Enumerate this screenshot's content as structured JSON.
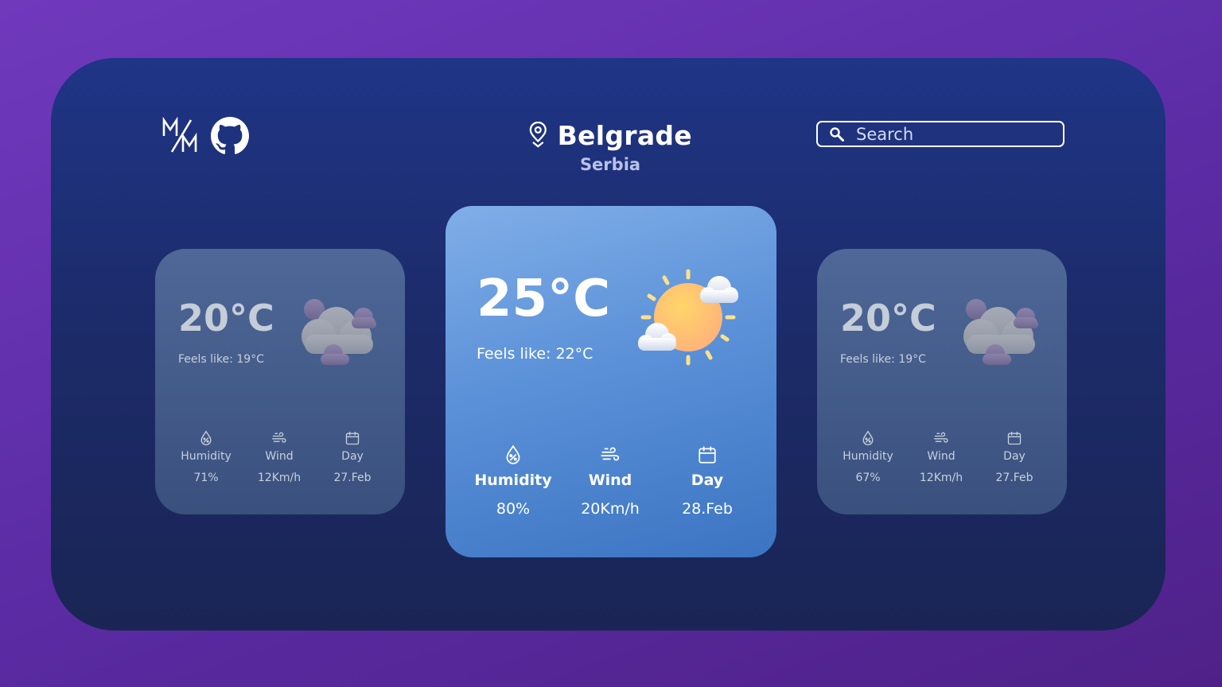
{
  "header": {
    "city": "Belgrade",
    "country": "Serbia",
    "search_placeholder": "Search"
  },
  "cards": {
    "left": {
      "temperature": "20°C",
      "feels_like": "Feels like: 19°C",
      "icon": "cloudy-icon",
      "humidity_label": "Humidity",
      "humidity_value": "71%",
      "wind_label": "Wind",
      "wind_value": "12Km/h",
      "day_label": "Day",
      "day_value": "27.Feb"
    },
    "main": {
      "temperature": "25°C",
      "feels_like": "Feels like: 22°C",
      "icon": "sun-with-clouds-icon",
      "humidity_label": "Humidity",
      "humidity_value": "80%",
      "wind_label": "Wind",
      "wind_value": "20Km/h",
      "day_label": "Day",
      "day_value": "28.Feb"
    },
    "right": {
      "temperature": "20°C",
      "feels_like": "Feels like: 19°C",
      "icon": "cloudy-icon",
      "humidity_label": "Humidity",
      "humidity_value": "67%",
      "wind_label": "Wind",
      "wind_value": "12Km/h",
      "day_label": "Day",
      "day_value": "27.Feb"
    }
  },
  "colors": {
    "background": "#6a34b5",
    "frame": "#1f3586",
    "main_card": "#5b91d8",
    "text": "#ffffff"
  }
}
